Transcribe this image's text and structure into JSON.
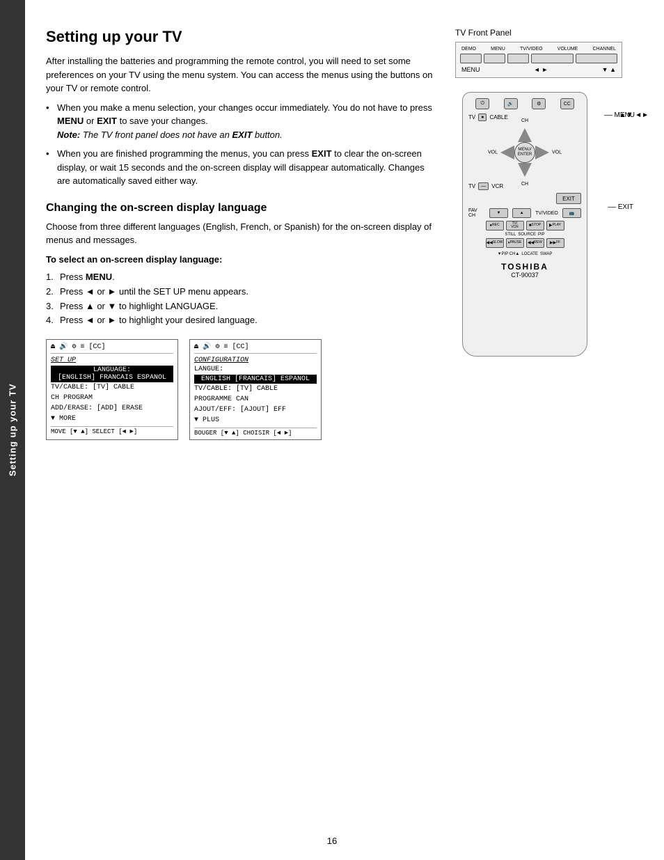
{
  "sidebar": {
    "text": "Setting up your TV"
  },
  "page": {
    "title": "Setting up your TV",
    "intro": "After installing the batteries and programming the remote control, you will need to set some preferences on your TV using the menu system. You can access the menus using the buttons on your TV or remote control.",
    "bullets": [
      {
        "text_before": "When you make a menu selection, your changes occur immediately. You do not have to press ",
        "bold1": "MENU",
        "text_mid": " or ",
        "bold2": "EXIT",
        "text_after": " to save your changes.",
        "note_label": "Note:",
        "note_text": " The TV front panel does not have an ",
        "note_bold": "EXIT",
        "note_end": " button."
      },
      {
        "text_before": "When you are finished programming the menus, you can press ",
        "bold1": "EXIT",
        "text_after": " to clear the on-screen display, or wait 15 seconds and the on-screen display will disappear automatically. Changes are automatically saved either way."
      }
    ],
    "section2_title": "Changing the on-screen display language",
    "section2_intro": "Choose from three different languages (English, French, or Spanish) for the on-screen display of menus and messages.",
    "steps_heading": "To select an on-screen display language:",
    "steps": [
      {
        "num": "1.",
        "text": "Press ",
        "bold": "MENU",
        "text_after": "."
      },
      {
        "num": "2.",
        "text": "Press ◄ or ► until the SET UP menu appears."
      },
      {
        "num": "3.",
        "text": "Press ▲ or ▼ to highlight LANGUAGE."
      },
      {
        "num": "4.",
        "text": "Press ◄ or ► to highlight your desired language."
      }
    ]
  },
  "menu_left": {
    "title": "SET UP",
    "lang_label": "LANGUAGE:",
    "lang_value": "[ENGLISH] FRANCAIS ESPANOL",
    "row1": "TV/CABLE:    [TV] CABLE",
    "row2": "CH PROGRAM",
    "row3": "ADD/ERASE:   [ADD] ERASE",
    "row4": "▼ MORE",
    "bottom": "MOVE [▼ ▲]    SELECT [◄ ►]"
  },
  "menu_right": {
    "title": "CONFIGURATION",
    "lang_label": "LANGUE:",
    "lang_value": "ENGLISH [FRANCAIS] ESPANOL",
    "row1": "TV/CABLE:    [TV] CABLE",
    "row2": "PROGRAMME CAN",
    "row3": "AJOUT/EFF:   [AJOUT] EFF",
    "row4": "▼ PLUS",
    "bottom": "BOUGER [▼ ▲]    CHOISIR [◄ ►]"
  },
  "tv_front_panel": {
    "label": "TV Front Panel",
    "top_labels": [
      "DEMO",
      "MENU",
      "TV/VIDEO",
      "VOLUME",
      "CHANNEL"
    ],
    "bottom_labels": [
      "MENU",
      "◄ ►",
      "▼ ▲"
    ]
  },
  "remote": {
    "label_menu": "MENU",
    "label_exit": "EXIT",
    "label_arrows": "▲▼ ◄►",
    "dpad_center": "MENU/ ENTER",
    "dpad_ch_up": "CH",
    "dpad_ch_down": "CH",
    "dpad_vol_left": "VOL",
    "dpad_vol_right": "VOL",
    "tv_cable_labels": [
      "TV",
      "CABLE",
      "TV/VCR",
      "STOP",
      "FAV CH",
      "TV/VIDEO"
    ],
    "rec_labels": [
      "REC",
      "TV/VCR",
      "STOP",
      "PLAY"
    ],
    "slow_labels": [
      "SLOW",
      "PAUSE",
      "REW",
      "FF"
    ],
    "pip_labels": [
      "▼PIP",
      "CH▲",
      "LOCATE",
      "SWAP"
    ],
    "brand": "TOSHIBA",
    "model": "CT-90037"
  },
  "page_number": "16"
}
